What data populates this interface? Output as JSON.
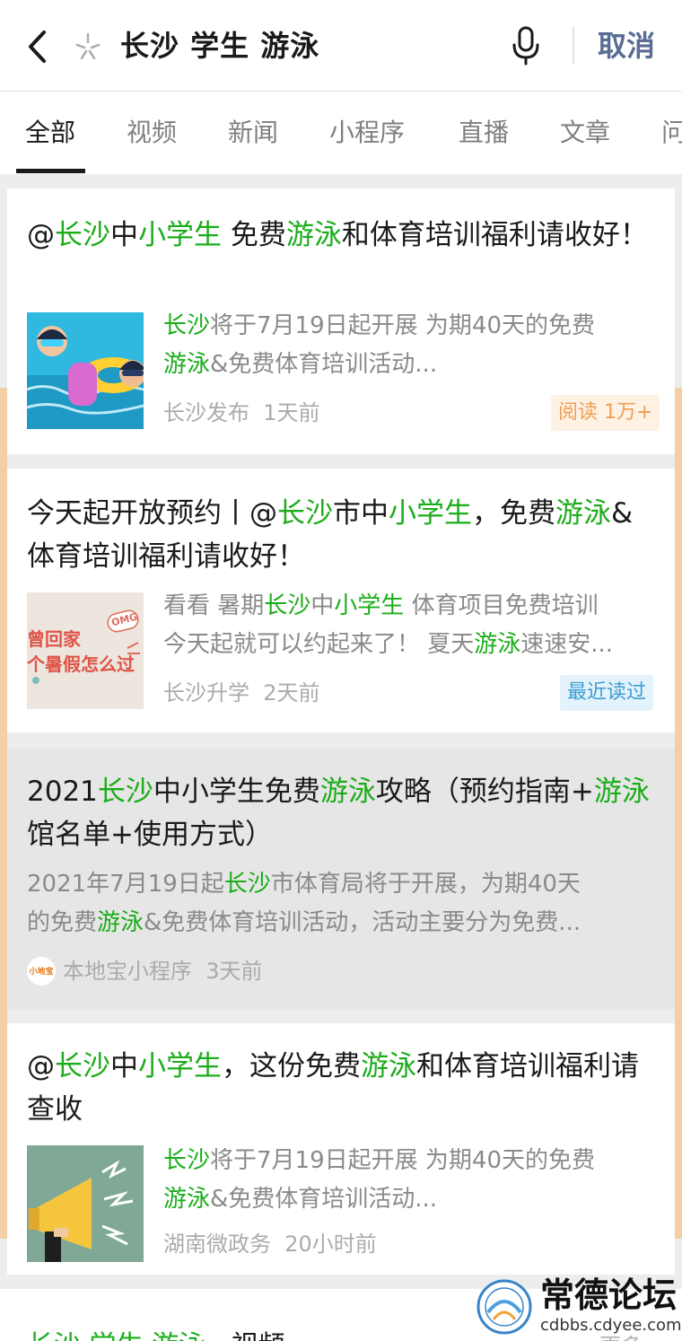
{
  "search": {
    "query": "长沙 学生 游泳",
    "cancel_label": "取消"
  },
  "tabs": [
    "全部",
    "视频",
    "新闻",
    "小程序",
    "直播",
    "文章",
    "问"
  ],
  "results": [
    {
      "title": [
        "@",
        "长沙",
        "中",
        "小学生",
        " 免费",
        "游泳",
        "和体育培训福利请收好！"
      ],
      "snippet_line1": [
        "长沙",
        "将于7月19日起开展 为期40天的免费"
      ],
      "snippet_line2": [
        "游泳",
        "&免费体育培训活动..."
      ],
      "source": "长沙发布",
      "time": "1天前",
      "badge": "阅读 1万+"
    },
    {
      "title": [
        "今天起开放预约丨@",
        "长沙",
        "市中",
        "小学生",
        "，免费",
        "游泳",
        "&体育培训福利请收好！"
      ],
      "snippet_line1": [
        "看看 暑期",
        "长沙",
        "中",
        "小学生",
        " 体育项目免费培训"
      ],
      "snippet_line2": [
        "今天起就可以约起来了！ 夏天",
        "游泳",
        "速速安..."
      ],
      "source": "长沙升学",
      "time": "2天前",
      "badge": "最近读过",
      "thumb_lines": [
        "曾回家",
        "个暑假怎么过"
      ],
      "thumb_tag": "OMG"
    },
    {
      "title": [
        "2021",
        "长沙",
        "中小学生免费",
        "游泳",
        "攻略（预约指南+",
        "游泳",
        "馆名单+使用方式）"
      ],
      "snippet_line1": [
        "2021年7月19日起",
        "长沙",
        "市体育局将于开展，为期40天"
      ],
      "snippet_line2": [
        "的免费",
        "游泳",
        "&免费体育培训活动，活动主要分为免费..."
      ],
      "source": "本地宝小程序",
      "time": "3天前",
      "avatar_text": "小地宝"
    },
    {
      "title": [
        "@",
        "长沙",
        "中",
        "小学生",
        "，这份免费",
        "游泳",
        "和体育培训福利请查收"
      ],
      "snippet_line1": [
        "长沙",
        "将于7月19日起开展 为期40天的免费"
      ],
      "snippet_line2": [
        "游泳",
        "&免费体育培训活动..."
      ],
      "source": "湖南微政务",
      "time": "20小时前"
    }
  ],
  "video_section": {
    "title": [
      "长沙 学生 游泳",
      " · 视频"
    ],
    "more": "更多 >"
  },
  "watermark": {
    "name": "常德论坛",
    "url": "cdbbs.cdyee.com",
    "seal_text": "常德论坛"
  },
  "colors": {
    "highlight": "#1aad19",
    "link_blue": "#586c94",
    "read_badge": "#ef9f53",
    "recent_badge": "#3a9dd4"
  }
}
